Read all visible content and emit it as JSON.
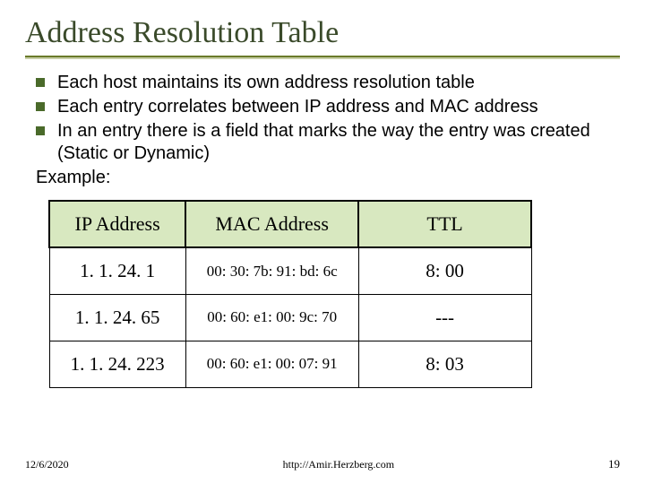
{
  "title": "Address Resolution Table",
  "bullets": [
    "Each host maintains its own address resolution table",
    "Each entry correlates between IP address and MAC address",
    "In an entry there is a field that marks the way the entry was created (Static or Dynamic)"
  ],
  "example_label": "Example:",
  "table": {
    "headers": {
      "ip": "IP Address",
      "mac": "MAC Address",
      "ttl": "TTL"
    },
    "rows": [
      {
        "ip": "1. 1. 24. 1",
        "mac": "00: 30: 7b: 91: bd: 6c",
        "ttl": "8: 00"
      },
      {
        "ip": "1. 1. 24. 65",
        "mac": "00: 60: e1: 00: 9c: 70",
        "ttl": "---"
      },
      {
        "ip": "1. 1. 24. 223",
        "mac": "00: 60: e1: 00: 07: 91",
        "ttl": "8: 03"
      }
    ]
  },
  "footer": {
    "date": "12/6/2020",
    "url": "http://Amir.Herzberg.com",
    "page": "19"
  }
}
